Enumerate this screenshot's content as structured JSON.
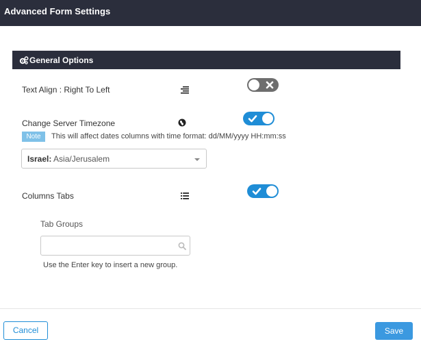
{
  "header": {
    "title": "Advanced Form Settings"
  },
  "section": {
    "title": "General Options",
    "icon": "gears-icon"
  },
  "options": {
    "text_align": {
      "label": "Text Align : Right To Left",
      "icon": "align-right-icon",
      "enabled": false
    },
    "server_timezone": {
      "label": "Change Server Timezone",
      "icon": "globe-icon",
      "enabled": true,
      "note_badge": "Note",
      "note_text": "This will affect dates columns with time format: dd/MM/yyyy HH:mm:ss",
      "timezone_country": "Israel:",
      "timezone_value": "Asia/Jerusalem"
    },
    "columns_tabs": {
      "label": "Columns Tabs",
      "icon": "list-icon",
      "enabled": true,
      "tab_groups_label": "Tab Groups",
      "tab_groups_value": "",
      "tab_groups_placeholder": "",
      "hint": "Use the Enter key to insert a new group."
    }
  },
  "footer": {
    "cancel_label": "Cancel",
    "save_label": "Save"
  },
  "colors": {
    "header_bg": "#2b2e3c",
    "accent": "#1f8dd6",
    "toggle_off": "#6e6e6e",
    "note_badge": "#7fc1e8"
  }
}
